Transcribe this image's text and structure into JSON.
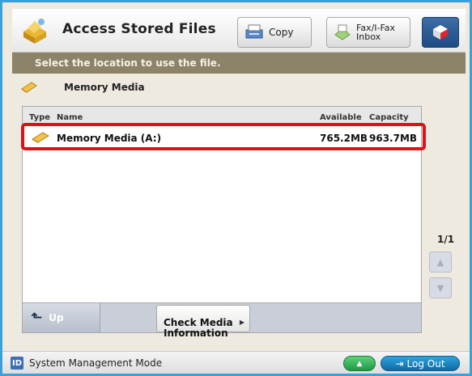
{
  "header": {
    "title": "Access Stored Files",
    "copy_label": "Copy",
    "fax_label": "Fax/I-Fax\nInbox"
  },
  "instruction": "Select the location to use the file.",
  "location": {
    "label": "Memory Media"
  },
  "table": {
    "columns": [
      "Type",
      "Name",
      "Available",
      "Capacity"
    ],
    "rows": [
      {
        "type_icon": "memory-media-icon",
        "name": "Memory Media (A:)",
        "available": "765.2MB",
        "capacity": "963.7MB"
      }
    ]
  },
  "controls": {
    "up_label": "Up",
    "check_media_label": "Check Media\nInformation"
  },
  "pagination": {
    "indicator": "1/1"
  },
  "status_bar": {
    "mode_label": "System Management Mode",
    "id_badge": "ID",
    "logout_label": "Log Out"
  },
  "colors": {
    "frame_border": "#3aa0d8",
    "instruction_bar": "#8c8369",
    "highlight": "#e0101a",
    "logout": "#0f6aa6",
    "green_button": "#1e9a46"
  }
}
